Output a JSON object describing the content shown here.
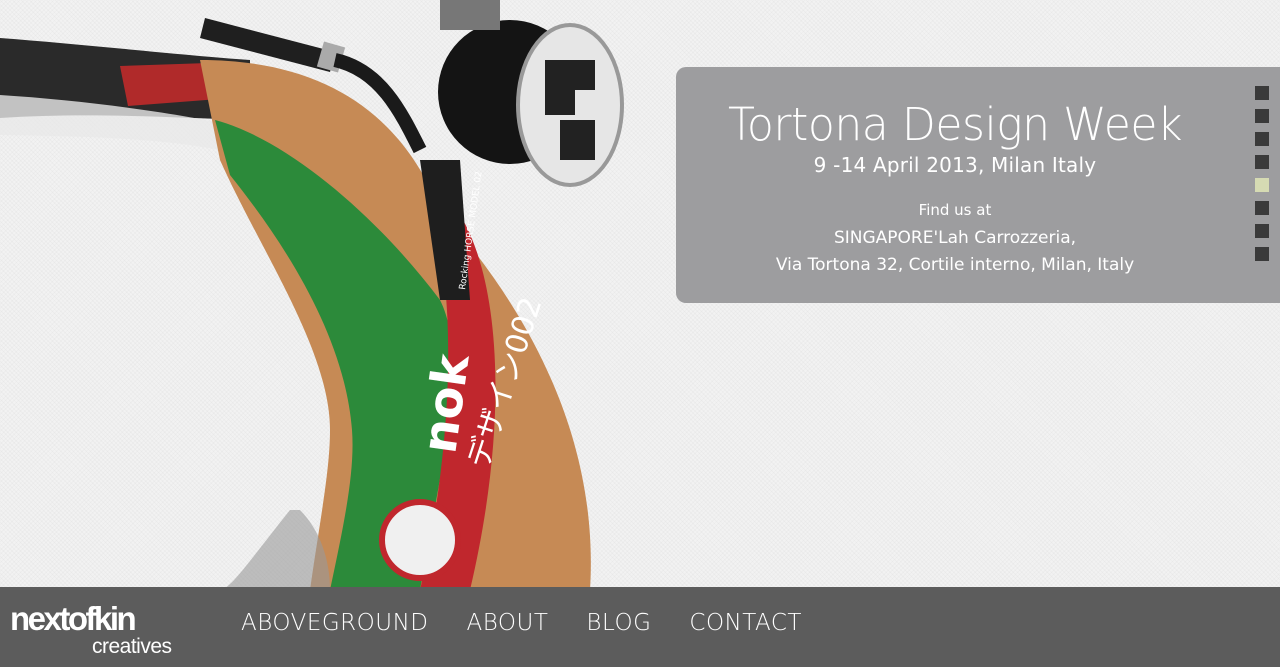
{
  "hero": {
    "title": "Tortona Design Week",
    "dates": "9 -14 April 2013, Milan Italy",
    "find_us": "Find us at",
    "venue_line1": "SINGAPORE'Lah Carrozzeria,",
    "venue_line2": "Via Tortona 32, Cortile interno, Milan, Italy"
  },
  "product_text": {
    "model_label": "Rocking HORSE MODEL 02",
    "brand": "nok",
    "katakana": "デザイン002"
  },
  "slideshow": {
    "total": 8,
    "active_index": 5,
    "colors": {
      "dot": "#3a3a3a",
      "active": "#d6dbb3"
    }
  },
  "logo": {
    "name": "nextofkin",
    "tagline": "creatives"
  },
  "nav": {
    "items": [
      {
        "label": "ABOVEGROUND"
      },
      {
        "label": "ABOUT"
      },
      {
        "label": "BLOG"
      },
      {
        "label": "CONTACT"
      }
    ]
  },
  "colors": {
    "panel": "#9d9d9f",
    "footer": "#5c5c5c",
    "text": "#ffffff"
  }
}
